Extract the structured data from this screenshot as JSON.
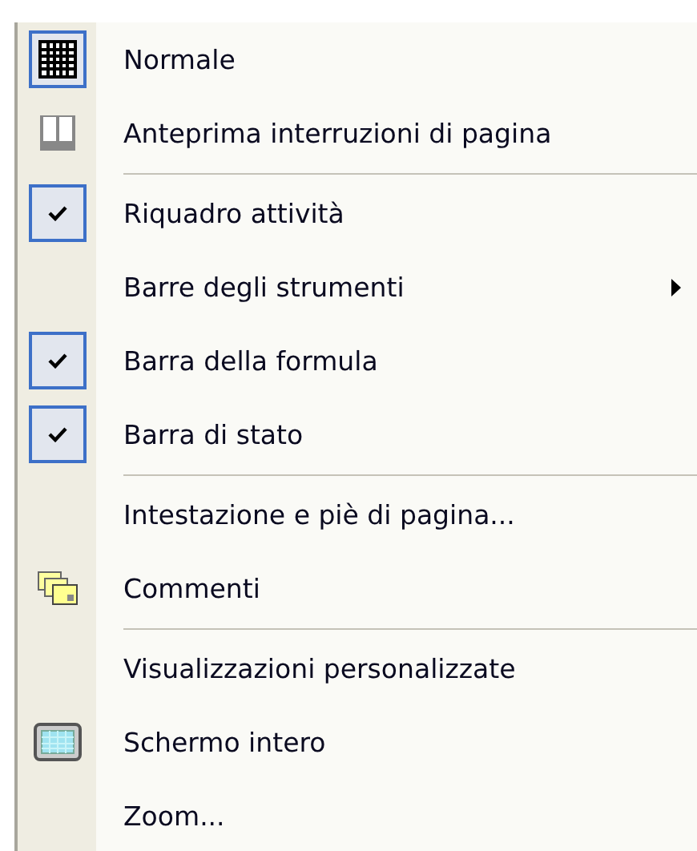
{
  "menu": {
    "items": [
      {
        "kind": "icon",
        "label": "Normale",
        "checked": true
      },
      {
        "kind": "icon",
        "label": "Anteprima interruzioni di pagina",
        "checked": false
      },
      {
        "kind": "separator"
      },
      {
        "kind": "check",
        "label": "Riquadro attività",
        "checked": true
      },
      {
        "kind": "submenu",
        "label": "Barre degli strumenti"
      },
      {
        "kind": "check",
        "label": "Barra della formula",
        "checked": true
      },
      {
        "kind": "check",
        "label": "Barra di stato",
        "checked": true
      },
      {
        "kind": "separator"
      },
      {
        "kind": "plain",
        "label": "Intestazione e piè di pagina..."
      },
      {
        "kind": "icon",
        "label": "Commenti",
        "checked": false
      },
      {
        "kind": "separator"
      },
      {
        "kind": "plain",
        "label": "Visualizzazioni personalizzate"
      },
      {
        "kind": "icon",
        "label": "Schermo intero",
        "checked": false
      },
      {
        "kind": "plain",
        "label": "Zoom..."
      }
    ]
  }
}
